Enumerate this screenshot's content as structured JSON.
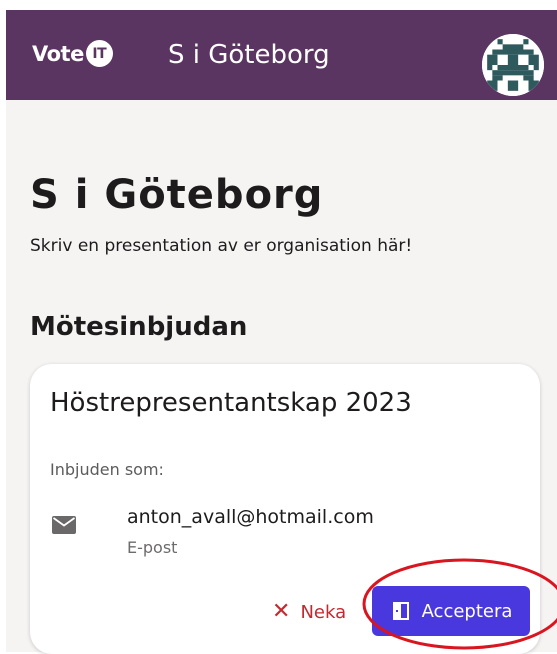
{
  "appbar": {
    "logo_text": "Vote",
    "logo_badge": "IT",
    "title": "S i Göteborg",
    "avatar_icon": "pixel-invader-avatar"
  },
  "page": {
    "title": "S i Göteborg",
    "description": "Skriv en presentation av er organisation här!",
    "section_title": "Mötesinbjudan"
  },
  "invitation": {
    "meeting_title": "Höstrepresentantskap 2023",
    "invited_as_label": "Inbjuden som:",
    "email": "anton_avall@hotmail.com",
    "email_type": "E-post",
    "decline_label": "Neka",
    "accept_label": "Acceptera"
  },
  "colors": {
    "appbar": "#5b3562",
    "accept": "#4a38df",
    "decline": "#c4292f",
    "highlight": "#d9151f"
  }
}
